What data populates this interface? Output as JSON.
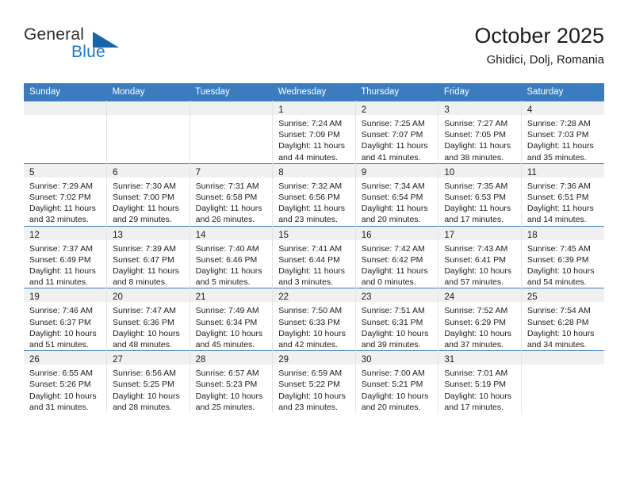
{
  "brand": {
    "name_top": "General",
    "name_bottom": "Blue",
    "color_top": "#2e2e2e",
    "color_bottom": "#1f78c1",
    "triangle_color": "#1565a8"
  },
  "header": {
    "title": "October 2025",
    "subtitle": "Ghidici, Dolj, Romania"
  },
  "theme": {
    "header_row_bg": "#3a7cbe",
    "header_row_text": "#ffffff",
    "daynum_strip_bg": "#f0f0f0",
    "cell_text": "#1c1c1c",
    "week_divider": "#3a7cbe"
  },
  "weekdays": [
    "Sunday",
    "Monday",
    "Tuesday",
    "Wednesday",
    "Thursday",
    "Friday",
    "Saturday"
  ],
  "labels": {
    "sunrise_prefix": "Sunrise:",
    "sunset_prefix": "Sunset:",
    "daylight_prefix": "Daylight:"
  },
  "weeks": [
    [
      {
        "day": "",
        "empty": true
      },
      {
        "day": "",
        "empty": true
      },
      {
        "day": "",
        "empty": true
      },
      {
        "day": "1",
        "sunrise": "Sunrise: 7:24 AM",
        "sunset": "Sunset: 7:09 PM",
        "daylight_1": "Daylight: 11 hours",
        "daylight_2": "and 44 minutes."
      },
      {
        "day": "2",
        "sunrise": "Sunrise: 7:25 AM",
        "sunset": "Sunset: 7:07 PM",
        "daylight_1": "Daylight: 11 hours",
        "daylight_2": "and 41 minutes."
      },
      {
        "day": "3",
        "sunrise": "Sunrise: 7:27 AM",
        "sunset": "Sunset: 7:05 PM",
        "daylight_1": "Daylight: 11 hours",
        "daylight_2": "and 38 minutes."
      },
      {
        "day": "4",
        "sunrise": "Sunrise: 7:28 AM",
        "sunset": "Sunset: 7:03 PM",
        "daylight_1": "Daylight: 11 hours",
        "daylight_2": "and 35 minutes."
      }
    ],
    [
      {
        "day": "5",
        "sunrise": "Sunrise: 7:29 AM",
        "sunset": "Sunset: 7:02 PM",
        "daylight_1": "Daylight: 11 hours",
        "daylight_2": "and 32 minutes."
      },
      {
        "day": "6",
        "sunrise": "Sunrise: 7:30 AM",
        "sunset": "Sunset: 7:00 PM",
        "daylight_1": "Daylight: 11 hours",
        "daylight_2": "and 29 minutes."
      },
      {
        "day": "7",
        "sunrise": "Sunrise: 7:31 AM",
        "sunset": "Sunset: 6:58 PM",
        "daylight_1": "Daylight: 11 hours",
        "daylight_2": "and 26 minutes."
      },
      {
        "day": "8",
        "sunrise": "Sunrise: 7:32 AM",
        "sunset": "Sunset: 6:56 PM",
        "daylight_1": "Daylight: 11 hours",
        "daylight_2": "and 23 minutes."
      },
      {
        "day": "9",
        "sunrise": "Sunrise: 7:34 AM",
        "sunset": "Sunset: 6:54 PM",
        "daylight_1": "Daylight: 11 hours",
        "daylight_2": "and 20 minutes."
      },
      {
        "day": "10",
        "sunrise": "Sunrise: 7:35 AM",
        "sunset": "Sunset: 6:53 PM",
        "daylight_1": "Daylight: 11 hours",
        "daylight_2": "and 17 minutes."
      },
      {
        "day": "11",
        "sunrise": "Sunrise: 7:36 AM",
        "sunset": "Sunset: 6:51 PM",
        "daylight_1": "Daylight: 11 hours",
        "daylight_2": "and 14 minutes."
      }
    ],
    [
      {
        "day": "12",
        "sunrise": "Sunrise: 7:37 AM",
        "sunset": "Sunset: 6:49 PM",
        "daylight_1": "Daylight: 11 hours",
        "daylight_2": "and 11 minutes."
      },
      {
        "day": "13",
        "sunrise": "Sunrise: 7:39 AM",
        "sunset": "Sunset: 6:47 PM",
        "daylight_1": "Daylight: 11 hours",
        "daylight_2": "and 8 minutes."
      },
      {
        "day": "14",
        "sunrise": "Sunrise: 7:40 AM",
        "sunset": "Sunset: 6:46 PM",
        "daylight_1": "Daylight: 11 hours",
        "daylight_2": "and 5 minutes."
      },
      {
        "day": "15",
        "sunrise": "Sunrise: 7:41 AM",
        "sunset": "Sunset: 6:44 PM",
        "daylight_1": "Daylight: 11 hours",
        "daylight_2": "and 3 minutes."
      },
      {
        "day": "16",
        "sunrise": "Sunrise: 7:42 AM",
        "sunset": "Sunset: 6:42 PM",
        "daylight_1": "Daylight: 11 hours",
        "daylight_2": "and 0 minutes."
      },
      {
        "day": "17",
        "sunrise": "Sunrise: 7:43 AM",
        "sunset": "Sunset: 6:41 PM",
        "daylight_1": "Daylight: 10 hours",
        "daylight_2": "and 57 minutes."
      },
      {
        "day": "18",
        "sunrise": "Sunrise: 7:45 AM",
        "sunset": "Sunset: 6:39 PM",
        "daylight_1": "Daylight: 10 hours",
        "daylight_2": "and 54 minutes."
      }
    ],
    [
      {
        "day": "19",
        "sunrise": "Sunrise: 7:46 AM",
        "sunset": "Sunset: 6:37 PM",
        "daylight_1": "Daylight: 10 hours",
        "daylight_2": "and 51 minutes."
      },
      {
        "day": "20",
        "sunrise": "Sunrise: 7:47 AM",
        "sunset": "Sunset: 6:36 PM",
        "daylight_1": "Daylight: 10 hours",
        "daylight_2": "and 48 minutes."
      },
      {
        "day": "21",
        "sunrise": "Sunrise: 7:49 AM",
        "sunset": "Sunset: 6:34 PM",
        "daylight_1": "Daylight: 10 hours",
        "daylight_2": "and 45 minutes."
      },
      {
        "day": "22",
        "sunrise": "Sunrise: 7:50 AM",
        "sunset": "Sunset: 6:33 PM",
        "daylight_1": "Daylight: 10 hours",
        "daylight_2": "and 42 minutes."
      },
      {
        "day": "23",
        "sunrise": "Sunrise: 7:51 AM",
        "sunset": "Sunset: 6:31 PM",
        "daylight_1": "Daylight: 10 hours",
        "daylight_2": "and 39 minutes."
      },
      {
        "day": "24",
        "sunrise": "Sunrise: 7:52 AM",
        "sunset": "Sunset: 6:29 PM",
        "daylight_1": "Daylight: 10 hours",
        "daylight_2": "and 37 minutes."
      },
      {
        "day": "25",
        "sunrise": "Sunrise: 7:54 AM",
        "sunset": "Sunset: 6:28 PM",
        "daylight_1": "Daylight: 10 hours",
        "daylight_2": "and 34 minutes."
      }
    ],
    [
      {
        "day": "26",
        "sunrise": "Sunrise: 6:55 AM",
        "sunset": "Sunset: 5:26 PM",
        "daylight_1": "Daylight: 10 hours",
        "daylight_2": "and 31 minutes."
      },
      {
        "day": "27",
        "sunrise": "Sunrise: 6:56 AM",
        "sunset": "Sunset: 5:25 PM",
        "daylight_1": "Daylight: 10 hours",
        "daylight_2": "and 28 minutes."
      },
      {
        "day": "28",
        "sunrise": "Sunrise: 6:57 AM",
        "sunset": "Sunset: 5:23 PM",
        "daylight_1": "Daylight: 10 hours",
        "daylight_2": "and 25 minutes."
      },
      {
        "day": "29",
        "sunrise": "Sunrise: 6:59 AM",
        "sunset": "Sunset: 5:22 PM",
        "daylight_1": "Daylight: 10 hours",
        "daylight_2": "and 23 minutes."
      },
      {
        "day": "30",
        "sunrise": "Sunrise: 7:00 AM",
        "sunset": "Sunset: 5:21 PM",
        "daylight_1": "Daylight: 10 hours",
        "daylight_2": "and 20 minutes."
      },
      {
        "day": "31",
        "sunrise": "Sunrise: 7:01 AM",
        "sunset": "Sunset: 5:19 PM",
        "daylight_1": "Daylight: 10 hours",
        "daylight_2": "and 17 minutes."
      },
      {
        "day": "",
        "empty": true
      }
    ]
  ]
}
